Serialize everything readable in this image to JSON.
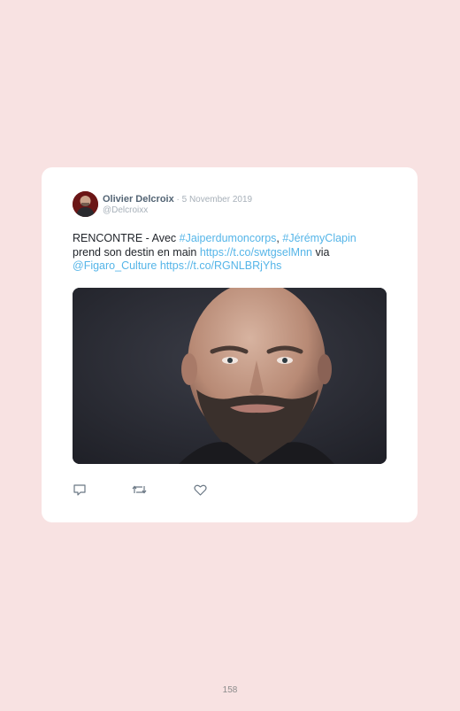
{
  "tweet": {
    "author_name": "Olivier Delcroix",
    "separator": " · ",
    "date": "5 November 2019",
    "handle": "@Delcroixx",
    "text": {
      "line1_prefix": "RENCONTRE - Avec ",
      "hashtag1": "#Jaiperdumoncorps",
      "comma": ", ",
      "hashtag2": "#JérémyClapin",
      "line2_prefix": "prend son destin en main ",
      "link1": "https://t.co/swtgselMnn",
      "via": " via",
      "mention": "@Figaro_Culture",
      "space": " ",
      "link2": "https://t.co/RGNLBRjYhs"
    },
    "actions": {
      "reply_icon": "reply-icon",
      "retweet_icon": "retweet-icon",
      "like_icon": "heart-icon"
    },
    "colors": {
      "link": "#55b5e8",
      "name": "#536474",
      "meta": "#a7b0b9",
      "page_background": "#f8e2e2"
    }
  },
  "page": {
    "number": "158"
  }
}
